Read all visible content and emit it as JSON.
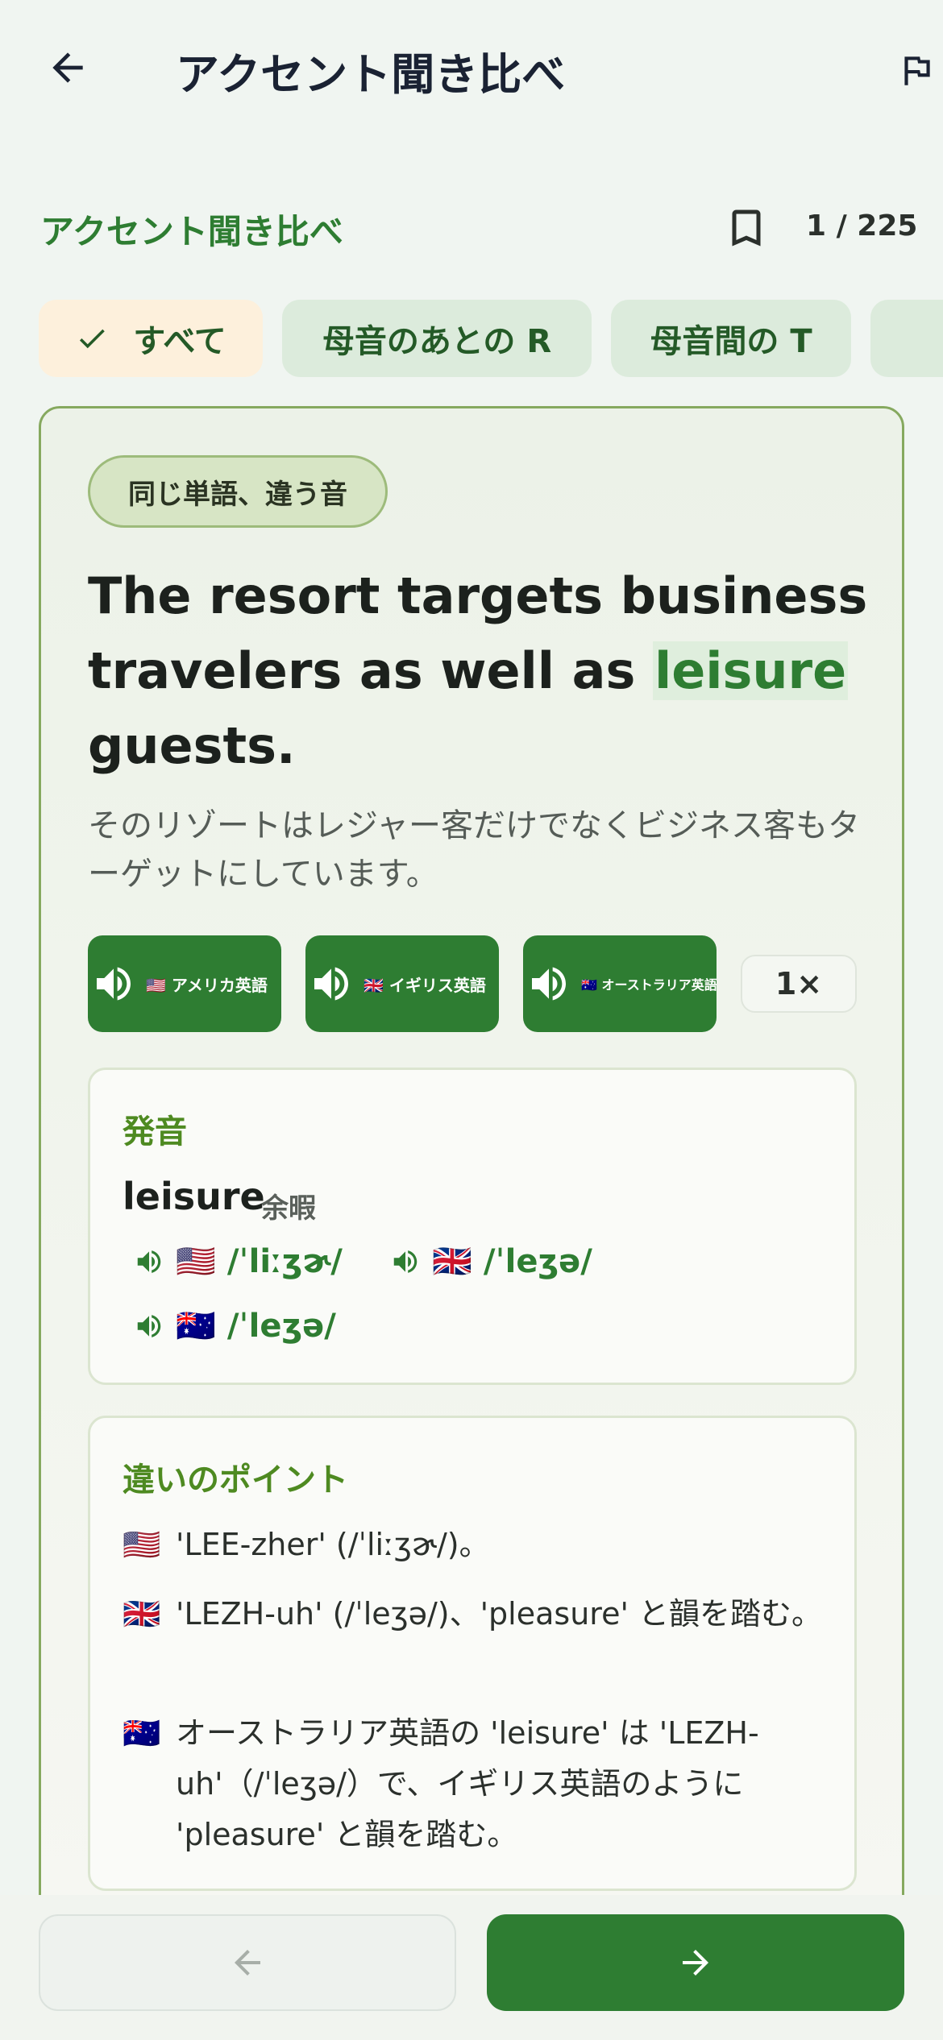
{
  "app_bar": {
    "title": "アクセント聞き比べ",
    "back_icon": "arrow-left-icon",
    "flag_icon": "flag-icon"
  },
  "header": {
    "section_title": "アクセント聞き比べ",
    "bookmark_icon": "bookmark-outline-icon",
    "counter": "1 / 225"
  },
  "filters": [
    {
      "label": "すべて",
      "selected": true
    },
    {
      "label": "母音のあとの R",
      "selected": false
    },
    {
      "label": "母音間の T",
      "selected": false
    }
  ],
  "card": {
    "tag": "同じ単語、違う音",
    "sentence_before": "The resort targets business travelers as well as ",
    "sentence_highlight": "leisure",
    "sentence_after": " guests.",
    "translation": "そのリゾートはレジャー客だけでなくビジネス客もターゲットにしています。",
    "audio_buttons": [
      {
        "label": "🇺🇸 アメリカ英語",
        "icon": "speaker-icon"
      },
      {
        "label": "🇬🇧 イギリス英語",
        "icon": "speaker-icon"
      },
      {
        "label": "🇦🇺 オーストラリア英語",
        "icon": "speaker-icon"
      }
    ],
    "speed": "1×"
  },
  "pronunciation": {
    "title": "発音",
    "word": "leisure",
    "meaning": "余暇",
    "ipa": [
      {
        "flag": "🇺🇸",
        "text": "/ˈliːʒɚ/"
      },
      {
        "flag": "🇬🇧",
        "text": "/ˈleʒə/"
      },
      {
        "flag": "🇦🇺",
        "text": "/ˈleʒə/"
      }
    ]
  },
  "differences": {
    "title": "違いのポイント",
    "points": [
      {
        "flag": "🇺🇸",
        "text": "'LEE-zher' (/ˈliːʒɚ/)。"
      },
      {
        "flag": "🇬🇧",
        "text": "'LEZH-uh' (/ˈleʒə/)、'pleasure' と韻を踏む。"
      },
      {
        "flag": "🇦🇺",
        "text": "オーストラリア英語の 'leisure' は 'LEZH-uh'（/ˈleʒə/）で、イギリス英語のように 'pleasure' と韻を踏む。"
      }
    ]
  },
  "navigation": {
    "prev_icon": "arrow-left-icon",
    "next_icon": "arrow-right-icon"
  },
  "colors": {
    "primary": "#2e7d32",
    "accent_text": "#4e8a21",
    "chip_bg": "#dcebdc",
    "chip_selected_bg": "#fdf0dc",
    "card_border": "#86a95f"
  }
}
